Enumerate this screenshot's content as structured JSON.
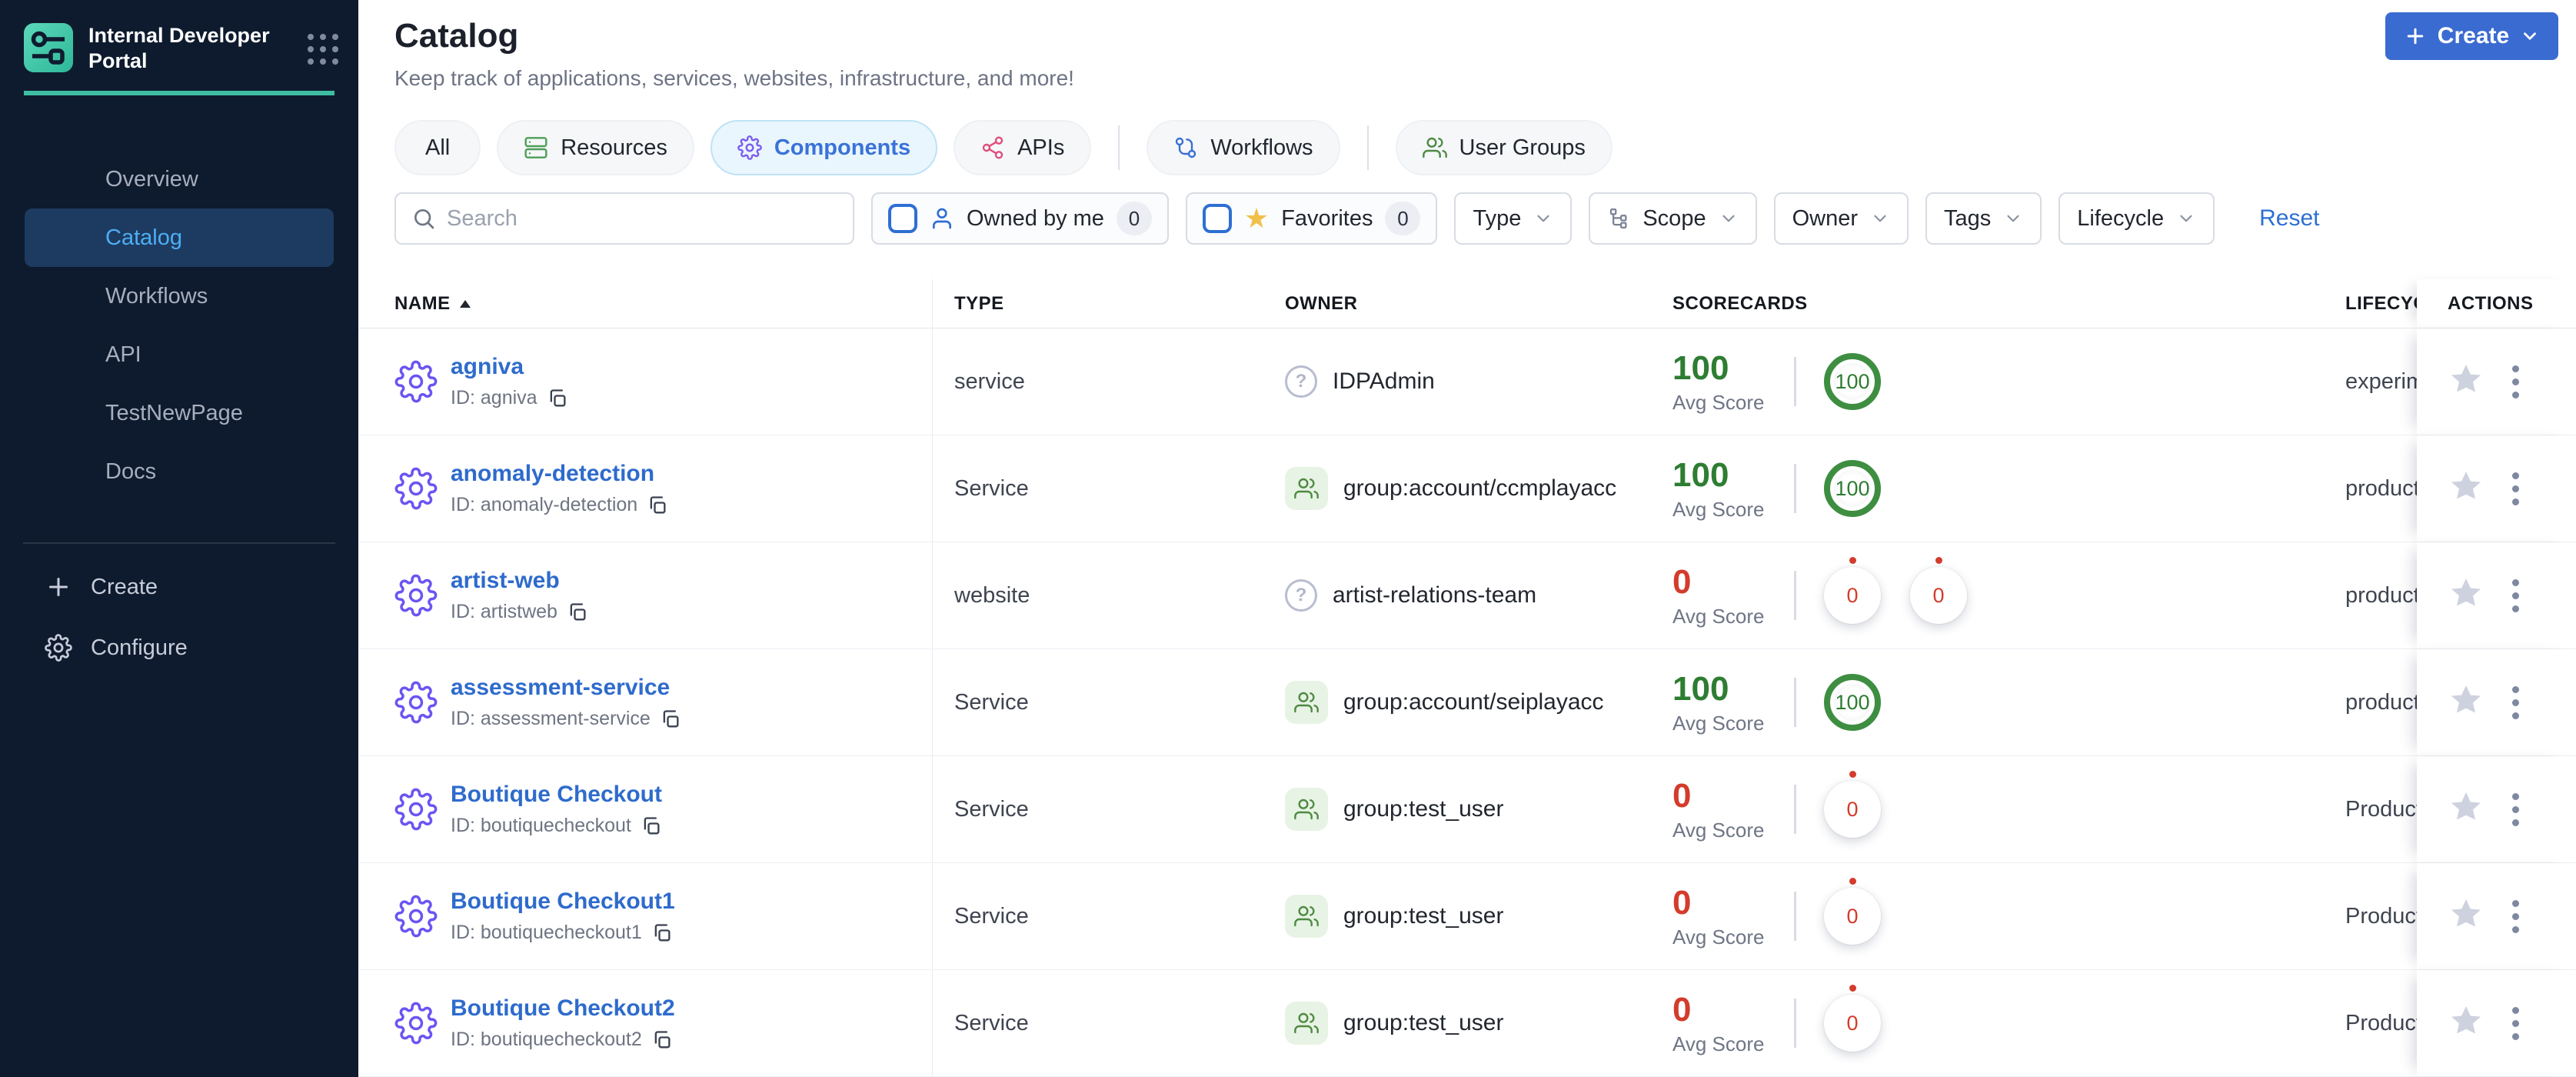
{
  "colors": {
    "sidebar_bg": "#0e1b2e",
    "accent_teal": "#3ebda3",
    "primary_blue": "#3a6bd1",
    "link_blue": "#2e6bcc",
    "active_nav_blue": "#4daef5",
    "gear_purple": "#6a55f2",
    "score_green": "#3e8e41",
    "score_red": "#d33c2c"
  },
  "sidebar": {
    "app_title": "Internal Developer Portal",
    "items": [
      {
        "label": "Overview"
      },
      {
        "label": "Catalog"
      },
      {
        "label": "Workflows"
      },
      {
        "label": "API"
      },
      {
        "label": "TestNewPage"
      },
      {
        "label": "Docs"
      }
    ],
    "footer": {
      "create_label": "Create",
      "configure_label": "Configure"
    }
  },
  "header": {
    "title": "Catalog",
    "subtitle": "Keep track of applications, services, websites, infrastructure, and more!",
    "create_button": "Create"
  },
  "tabs": [
    {
      "label": "All"
    },
    {
      "label": "Resources"
    },
    {
      "label": "Components"
    },
    {
      "label": "APIs"
    },
    {
      "label": "Workflows"
    },
    {
      "label": "User Groups"
    }
  ],
  "filters": {
    "search_placeholder": "Search",
    "owned_by_me": {
      "label": "Owned by me",
      "count": "0"
    },
    "favorites": {
      "label": "Favorites",
      "count": "0"
    },
    "dropdowns": [
      {
        "label": "Type"
      },
      {
        "label": "Scope"
      },
      {
        "label": "Owner"
      },
      {
        "label": "Tags"
      },
      {
        "label": "Lifecycle"
      }
    ],
    "reset_label": "Reset"
  },
  "table": {
    "columns": [
      {
        "label": "NAME"
      },
      {
        "label": "TYPE"
      },
      {
        "label": "OWNER"
      },
      {
        "label": "SCORECARDS"
      },
      {
        "label": "LIFECYCLE"
      },
      {
        "label": "ACTIONS"
      }
    ],
    "avg_score_label": "Avg Score",
    "unknown_owner_glyph": "?",
    "rows": [
      {
        "name": "agniva",
        "id_label": "ID: agniva",
        "type": "service",
        "owner": {
          "kind": "user",
          "label": "IDPAdmin"
        },
        "score": {
          "value": "100",
          "tone": "green",
          "circles": [
            {
              "value": "100",
              "variant": "green"
            }
          ]
        },
        "lifecycle": "experimental"
      },
      {
        "name": "anomaly-detection",
        "id_label": "ID: anomaly-detection",
        "type": "Service",
        "owner": {
          "kind": "group",
          "label": "group:account/ccmplayacc"
        },
        "score": {
          "value": "100",
          "tone": "green",
          "circles": [
            {
              "value": "100",
              "variant": "green"
            }
          ]
        },
        "lifecycle": "production"
      },
      {
        "name": "artist-web",
        "id_label": "ID: artistweb",
        "type": "website",
        "owner": {
          "kind": "user",
          "label": "artist-relations-team"
        },
        "score": {
          "value": "0",
          "tone": "red",
          "circles": [
            {
              "value": "0",
              "variant": "zero"
            },
            {
              "value": "0",
              "variant": "zero"
            }
          ]
        },
        "lifecycle": "production"
      },
      {
        "name": "assessment-service",
        "id_label": "ID: assessment-service",
        "type": "Service",
        "owner": {
          "kind": "group",
          "label": "group:account/seiplayacc"
        },
        "score": {
          "value": "100",
          "tone": "green",
          "circles": [
            {
              "value": "100",
              "variant": "green"
            }
          ]
        },
        "lifecycle": "production"
      },
      {
        "name": "Boutique Checkout",
        "id_label": "ID: boutiquecheckout",
        "type": "Service",
        "owner": {
          "kind": "group",
          "label": "group:test_user"
        },
        "score": {
          "value": "0",
          "tone": "red",
          "circles": [
            {
              "value": "0",
              "variant": "zero"
            }
          ]
        },
        "lifecycle": "Production"
      },
      {
        "name": "Boutique Checkout1",
        "id_label": "ID: boutiquecheckout1",
        "type": "Service",
        "owner": {
          "kind": "group",
          "label": "group:test_user"
        },
        "score": {
          "value": "0",
          "tone": "red",
          "circles": [
            {
              "value": "0",
              "variant": "zero"
            }
          ]
        },
        "lifecycle": "Production"
      },
      {
        "name": "Boutique Checkout2",
        "id_label": "ID: boutiquecheckout2",
        "type": "Service",
        "owner": {
          "kind": "group",
          "label": "group:test_user"
        },
        "score": {
          "value": "0",
          "tone": "red",
          "circles": [
            {
              "value": "0",
              "variant": "zero"
            }
          ]
        },
        "lifecycle": "Production"
      }
    ]
  }
}
